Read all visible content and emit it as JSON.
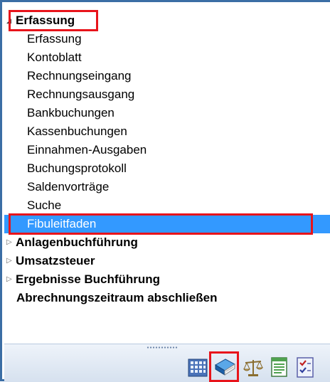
{
  "tree": {
    "erfassung_group": {
      "label": "Erfassung",
      "expanded": true
    },
    "children": [
      {
        "label": "Erfassung"
      },
      {
        "label": "Kontoblatt"
      },
      {
        "label": "Rechnungseingang"
      },
      {
        "label": "Rechnungsausgang"
      },
      {
        "label": "Bankbuchungen"
      },
      {
        "label": "Kassenbuchungen"
      },
      {
        "label": "Einnahmen-Ausgaben"
      },
      {
        "label": "Buchungsprotokoll"
      },
      {
        "label": "Saldenvorträge"
      },
      {
        "label": "Suche"
      },
      {
        "label": "Fibuleitfaden",
        "selected": true
      }
    ],
    "groups": [
      {
        "label": "Anlagenbuchführung",
        "expanded": false
      },
      {
        "label": "Umsatzsteuer",
        "expanded": false
      },
      {
        "label": "Ergebnisse Buchführung",
        "expanded": false
      }
    ],
    "final_item": {
      "label": "Abrechnungszeitraum abschließen"
    }
  },
  "toolbar": {
    "icons": [
      "building-grid-icon",
      "book-icon",
      "scales-icon",
      "ledger-sheet-icon",
      "checklist-icon"
    ],
    "active_icon": "book-icon"
  },
  "colors": {
    "selection": "#3399ff",
    "highlight": "#e8141b",
    "frame": "#3b6ea5"
  }
}
